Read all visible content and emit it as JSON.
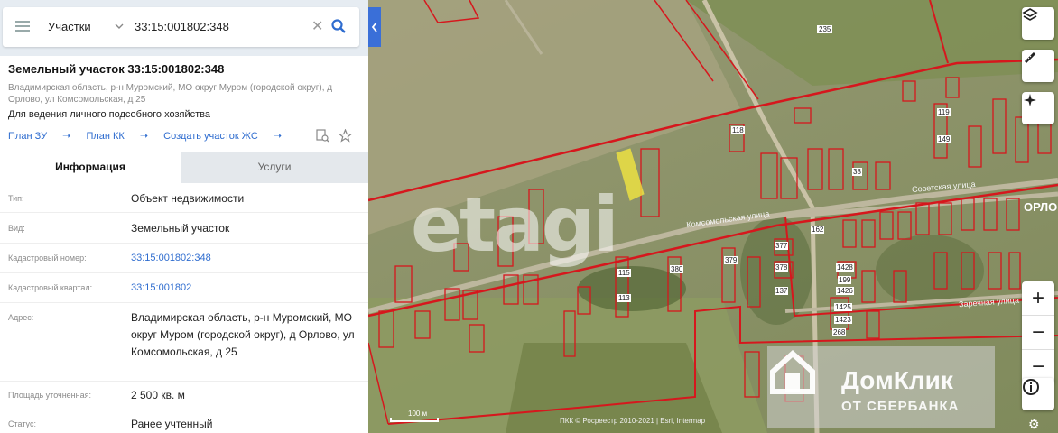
{
  "search": {
    "type_label": "Участки",
    "query": "33:15:001802:348"
  },
  "parcel": {
    "title": "Земельный участок 33:15:001802:348",
    "address": "Владимирская область, р-н Муромский, МО округ Муром (городской округ), д Орлово, ул Комсомольская, д 25",
    "purpose": "Для ведения личного подсобного хозяйства",
    "links": [
      "План ЗУ",
      "План КК",
      "Создать участок ЖС"
    ]
  },
  "tabs": [
    "Информация",
    "Услуги"
  ],
  "info": [
    {
      "key": "Тип:",
      "value": "Объект недвижимости"
    },
    {
      "key": "Вид:",
      "value": "Земельный участок"
    },
    {
      "key": "Кадастровый номер:",
      "value": "33:15:001802:348"
    },
    {
      "key": "Кадастровый квартал:",
      "value": "33:15:001802"
    },
    {
      "key": "Адрес:",
      "value": "Владимирская область, р-н Муромский, МО округ Муром (городской округ), д Орлово, ул Комсомольская, д 25"
    },
    {
      "key": "Площадь уточненная:",
      "value": "2 500 кв. м"
    },
    {
      "key": "Статус:",
      "value": "Ранее учтенный"
    }
  ],
  "map": {
    "watermark": "etagi",
    "brand_line1": "ДомКлик",
    "brand_line2": "ОТ СБЕРБАНКА",
    "scale_label": "100 м",
    "copyright": "ПКК © Росреестр 2010-2021 | Esri, Intermap",
    "road_number": "235",
    "streets": [
      "Комсомольская улица",
      "Советская улица",
      "Заречная улица"
    ],
    "village_label": "ОРЛО",
    "parcel_numbers": [
      "118",
      "377",
      "378",
      "38",
      "119",
      "137",
      "1428",
      "1426",
      "1425",
      "1423",
      "199",
      "162",
      "380",
      "379",
      "115",
      "113",
      "149",
      "268"
    ]
  },
  "colors": {
    "boundary": "#d6171d",
    "highlight": "#f2e640",
    "link": "#2e6ccf",
    "accent": "#3a6fd8"
  }
}
